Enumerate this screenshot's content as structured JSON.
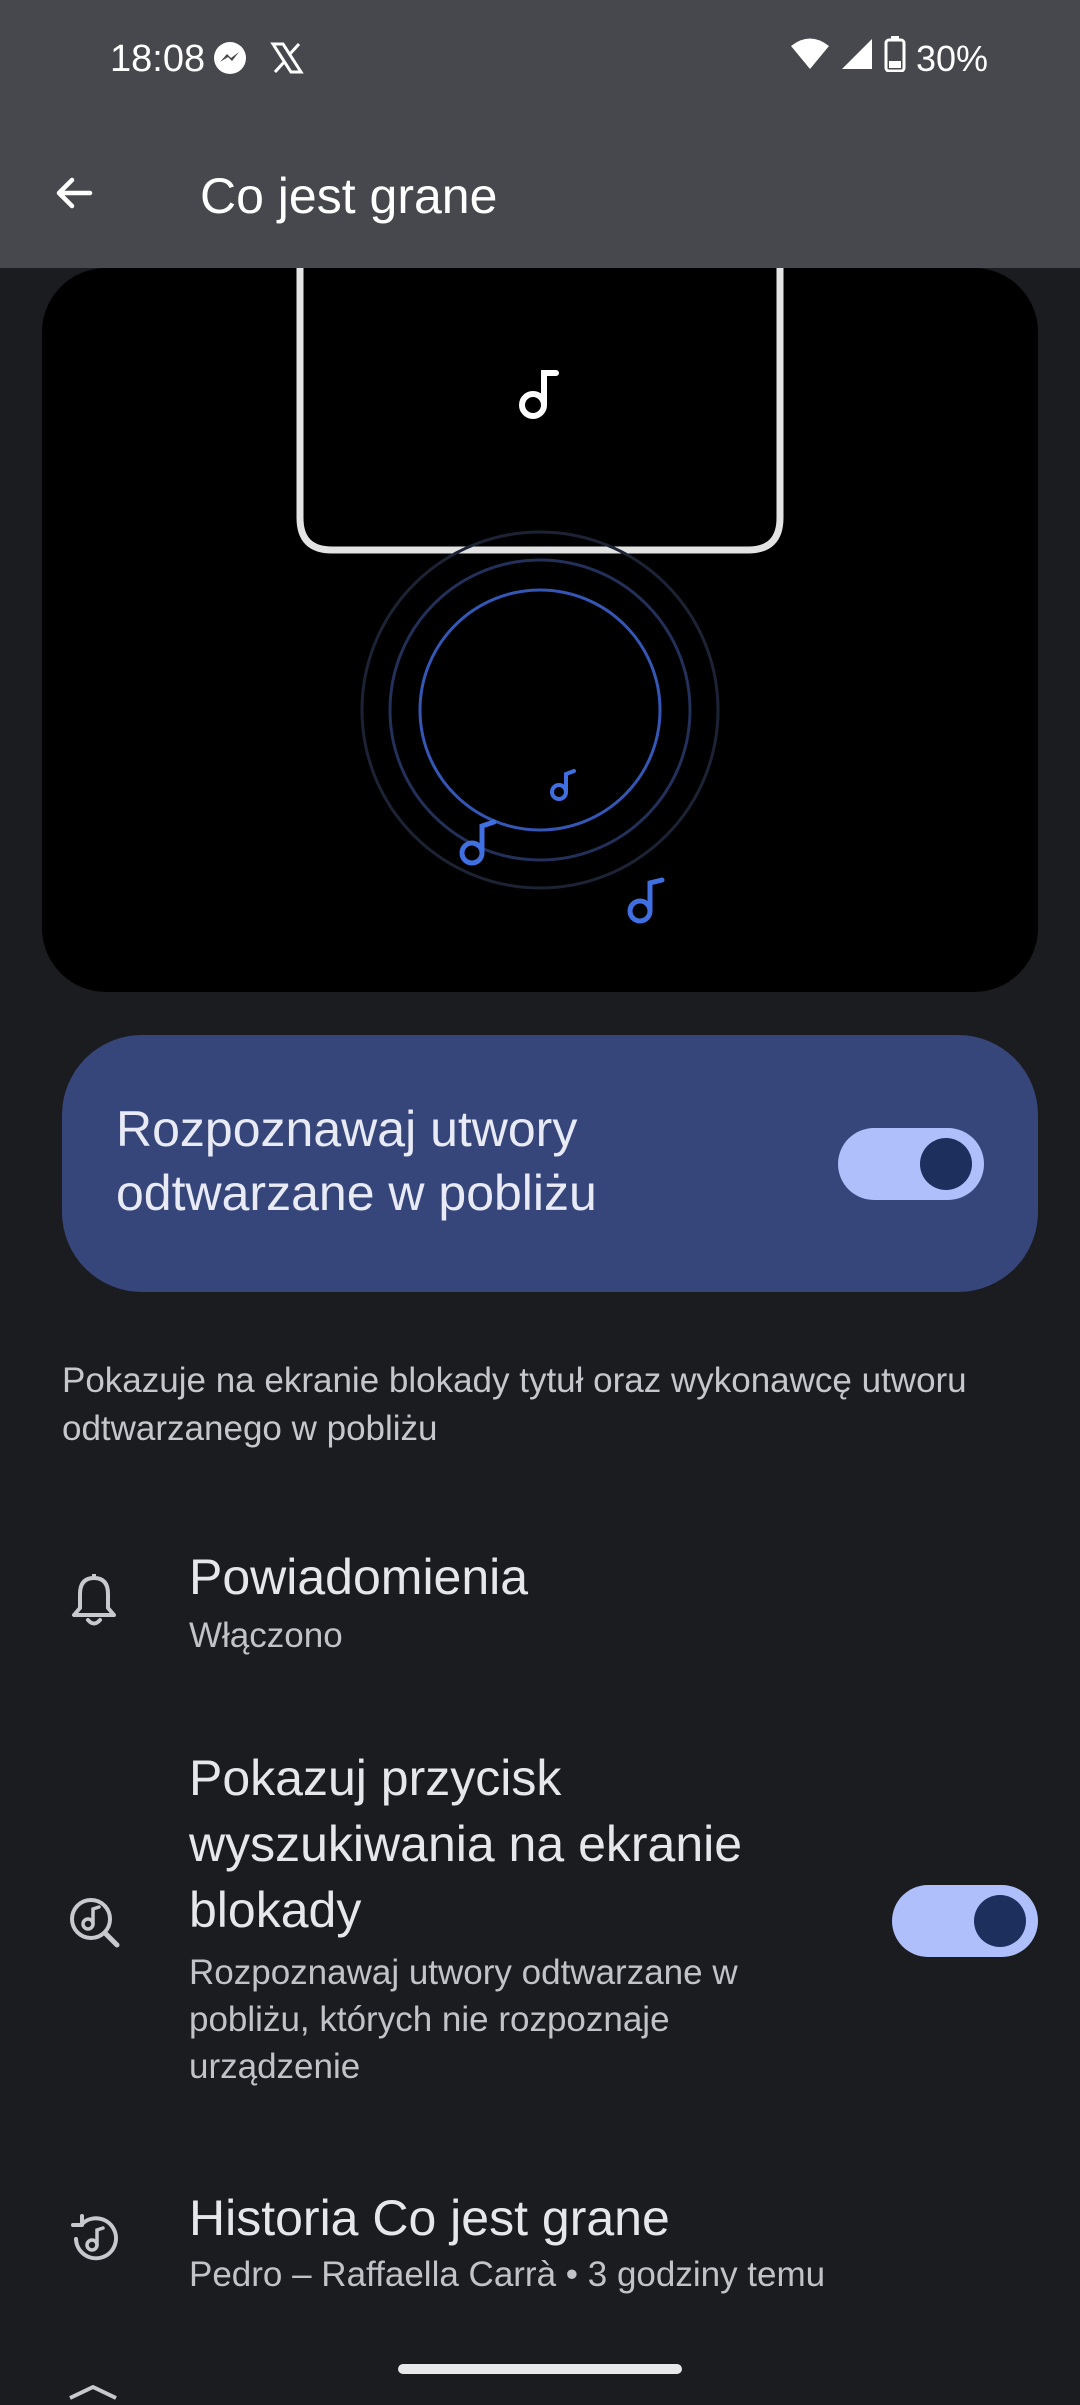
{
  "status_bar": {
    "time": "18:08",
    "battery": "30%",
    "left_icons": [
      "messenger-icon",
      "x-icon"
    ],
    "right_icons": [
      "wifi-icon",
      "signal-icon",
      "battery-icon"
    ]
  },
  "app_bar": {
    "title": "Co jest grane",
    "back_icon": "arrow-back-icon"
  },
  "main_toggle": {
    "label": "Rozpoznawaj utwory odtwarzane w pobliżu",
    "enabled": true
  },
  "description": "Pokazuje na ekranie blokady tytuł oraz wykonawcę utworu odtwarzanego w pobliżu",
  "preferences": [
    {
      "icon": "bell-icon",
      "title": "Powiadomienia",
      "subtitle": "Włączono"
    },
    {
      "icon": "music-search-icon",
      "title": "Pokazuj przycisk wyszukiwania na ekranie blokady",
      "subtitle": "Rozpoznawaj utwory odtwarzane w pobliżu, których nie rozpoznaje urządzenie",
      "toggle_enabled": true
    },
    {
      "icon": "history-music-icon",
      "title": "Historia Co jest grane",
      "subtitle": "Pedro – Raffaella Carrà • 3 godziny temu"
    }
  ],
  "colors": {
    "background": "#1b1c20",
    "app_bar": "#47484d",
    "card": "#37467a",
    "toggle_track": "#aebffc",
    "toggle_knob": "#1c2f5d",
    "accent_note": "#3f6fe0"
  }
}
